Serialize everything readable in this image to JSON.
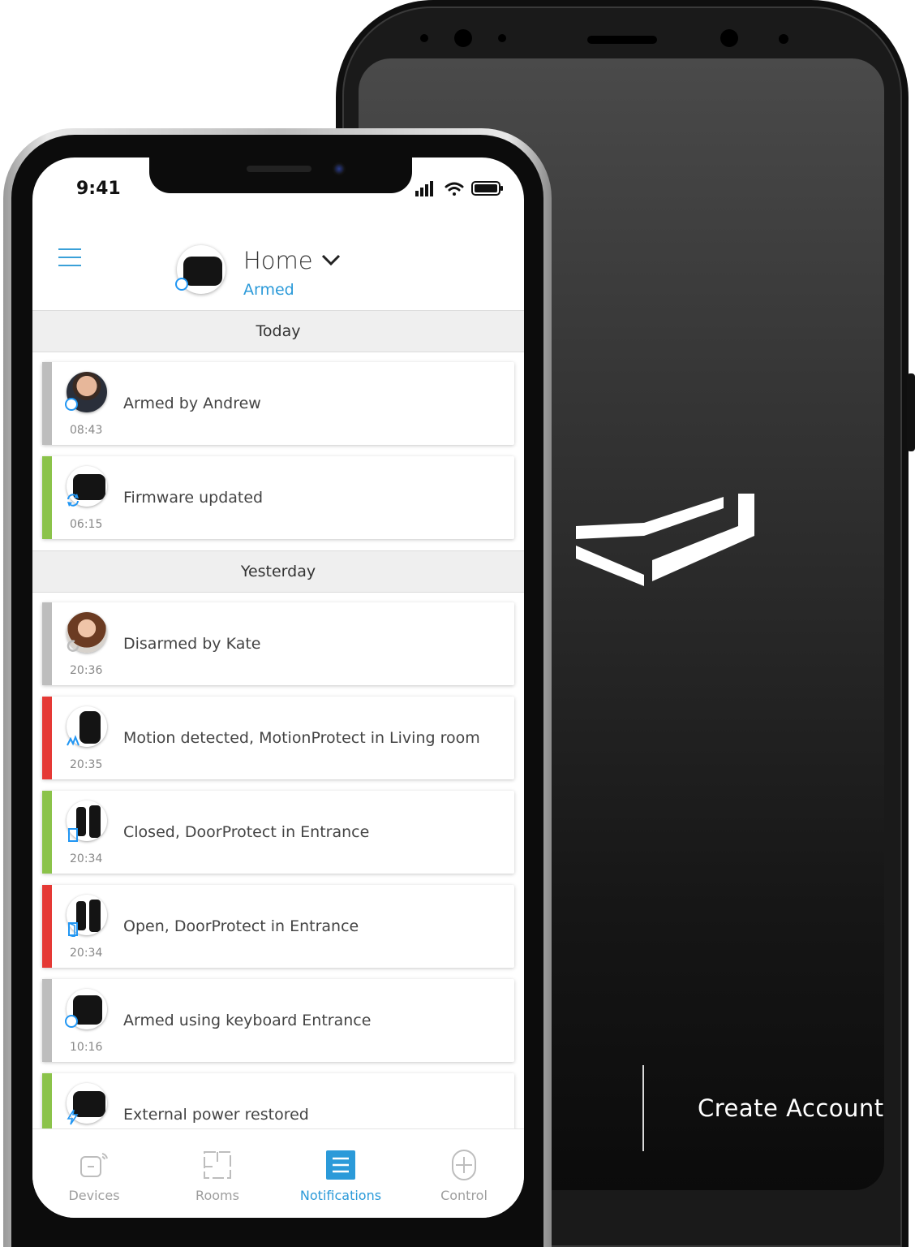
{
  "status_bar": {
    "time": "9:41"
  },
  "header": {
    "hub_name": "Home",
    "hub_status": "Armed"
  },
  "sections": [
    {
      "label": "Today"
    },
    {
      "label": "Yesterday"
    }
  ],
  "events": [
    {
      "text": "Armed by Andrew",
      "time": "08:43",
      "bar_color": "#bdbdbd",
      "icon": "armed-icon"
    },
    {
      "text": "Firmware updated",
      "time": "06:15",
      "bar_color": "#8bc34a",
      "icon": "sync-icon"
    },
    {
      "text": "Disarmed by Kate",
      "time": "20:36",
      "bar_color": "#bdbdbd",
      "icon": "disarmed-icon"
    },
    {
      "text": "Motion detected, MotionProtect in Living room",
      "time": "20:35",
      "bar_color": "#e53935",
      "icon": "motion-icon"
    },
    {
      "text": "Closed, DoorProtect in Entrance",
      "time": "20:34",
      "bar_color": "#8bc34a",
      "icon": "door-icon"
    },
    {
      "text": "Open, DoorProtect in Entrance",
      "time": "20:34",
      "bar_color": "#e53935",
      "icon": "door-icon"
    },
    {
      "text": "Armed using keyboard Entrance",
      "time": "10:16",
      "bar_color": "#bdbdbd",
      "icon": "armed-icon"
    },
    {
      "text": "External power restored",
      "time": "",
      "bar_color": "#8bc34a",
      "icon": "power-icon"
    }
  ],
  "tabs": [
    {
      "label": "Devices",
      "icon": "devices-icon"
    },
    {
      "label": "Rooms",
      "icon": "rooms-icon"
    },
    {
      "label": "Notifications",
      "icon": "notifications-icon",
      "active": true
    },
    {
      "label": "Control",
      "icon": "control-icon"
    }
  ],
  "android": {
    "cta": "Create Account"
  },
  "colors": {
    "accent": "#2b9ad9",
    "ok": "#8bc34a",
    "alarm": "#e53935",
    "neutral": "#bdbdbd"
  }
}
